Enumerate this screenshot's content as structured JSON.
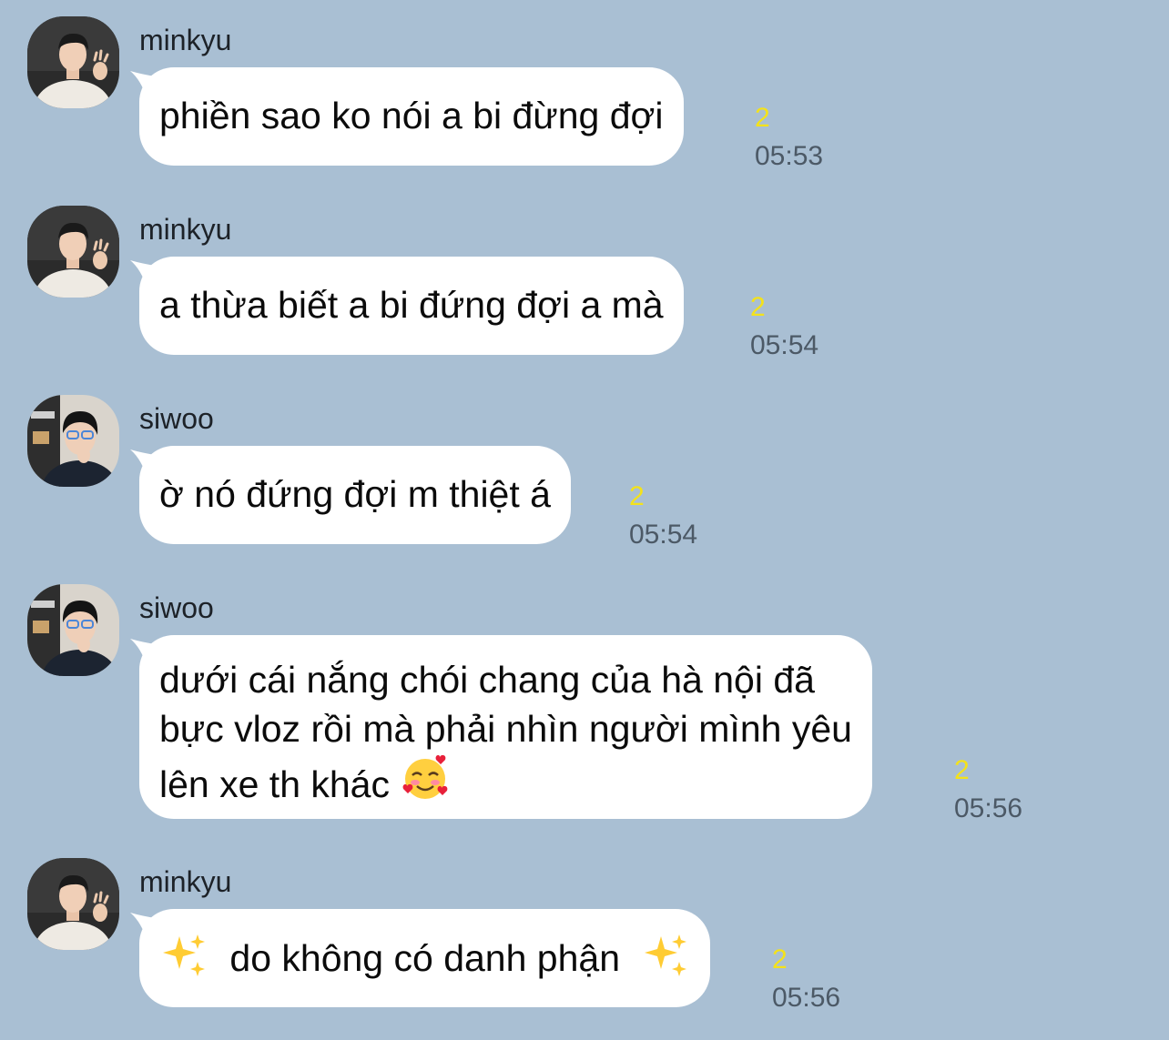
{
  "messages": [
    {
      "sender": "minkyu",
      "text_lines": [
        "phiền sao ko nói a bi đừng đợi"
      ],
      "unread": "2",
      "time": "05:53",
      "avatar": "avatar-minkyu"
    },
    {
      "sender": "minkyu",
      "text_lines": [
        "a thừa biết a bi đứng đợi a mà"
      ],
      "unread": "2",
      "time": "05:54",
      "avatar": "avatar-minkyu"
    },
    {
      "sender": "siwoo",
      "text_lines": [
        "ờ nó đứng đợi m thiệt á"
      ],
      "unread": "2",
      "time": "05:54",
      "avatar": "avatar-siwoo"
    },
    {
      "sender": "siwoo",
      "text_lines": [
        "dưới cái nắng chói chang của hà nội đã",
        "bực vloz rồi mà phải nhìn người mình yêu",
        "lên xe th khác"
      ],
      "trailing_emoji": "smiling-face-with-hearts-emoji",
      "unread": "2",
      "time": "05:56",
      "avatar": "avatar-siwoo"
    },
    {
      "sender": "minkyu",
      "text_lines": [
        "do không có danh phận"
      ],
      "leading_emoji": "sparkles-emoji",
      "trailing_emoji": "sparkles-emoji",
      "unread": "2",
      "time": "05:56",
      "avatar": "avatar-minkyu"
    }
  ],
  "colors": {
    "background": "#a9bfd3",
    "bubble": "#ffffff",
    "unread": "#f4e21a",
    "time": "#4c5966"
  }
}
